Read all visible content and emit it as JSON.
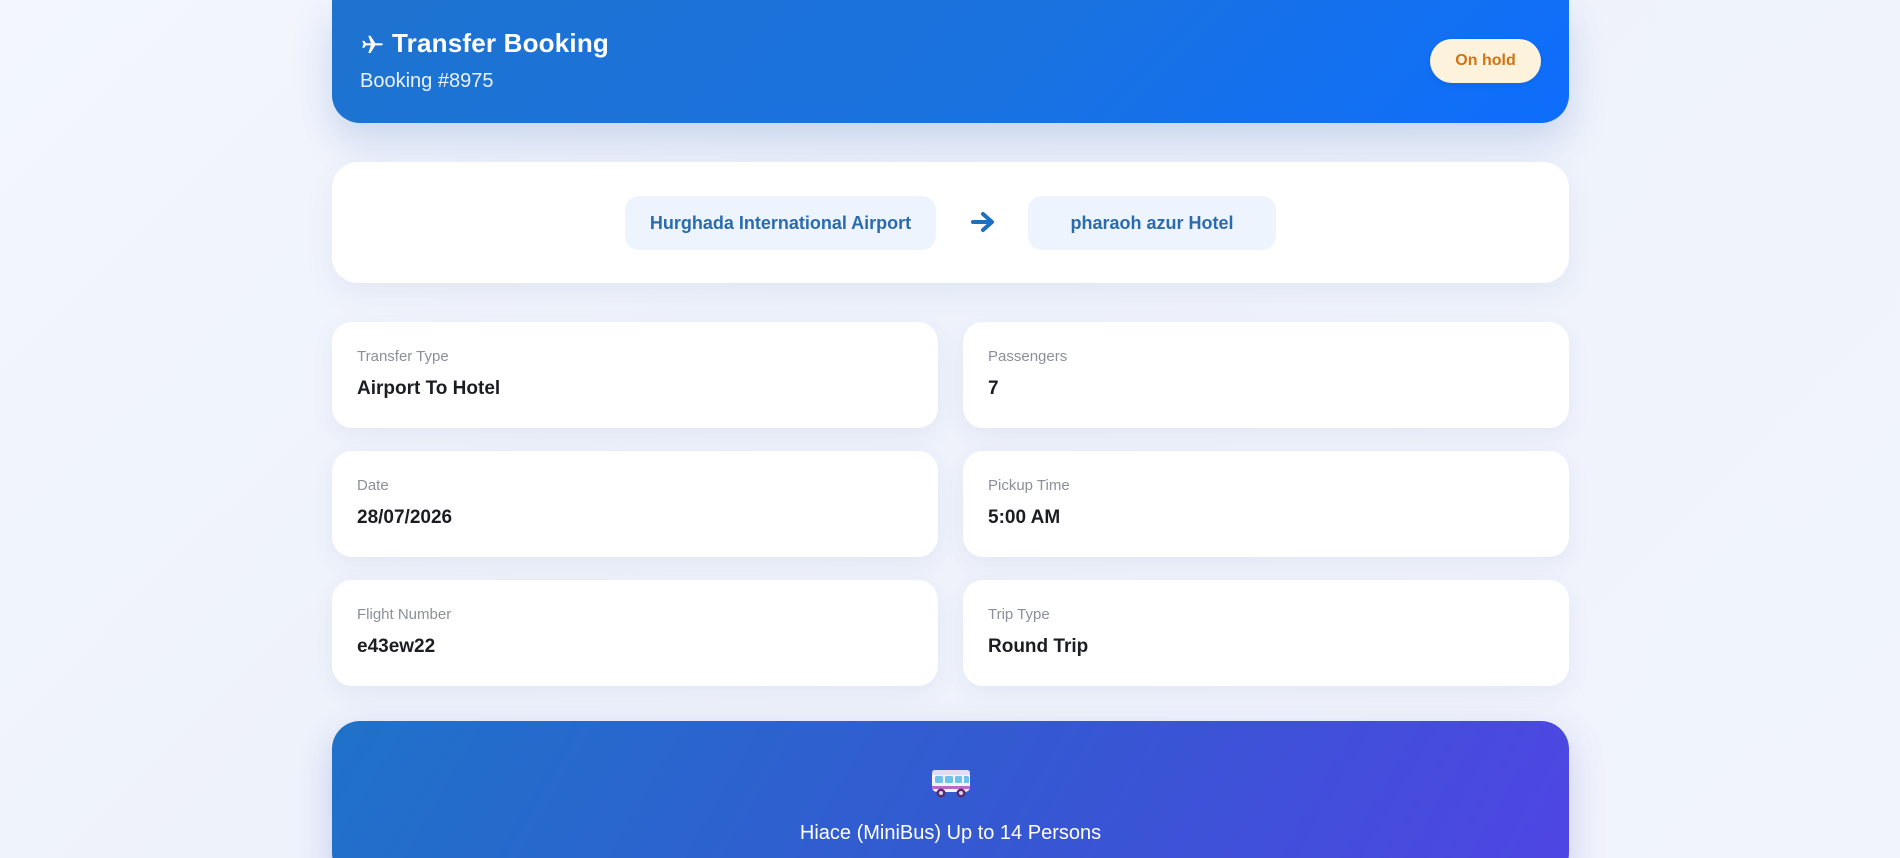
{
  "header": {
    "title": "Transfer Booking",
    "booking_number": "Booking #8975",
    "status": "On hold"
  },
  "route": {
    "from": "Hurghada International Airport",
    "to": "pharaoh azur Hotel"
  },
  "details": {
    "transfer_type": {
      "label": "Transfer Type",
      "value": "Airport To Hotel"
    },
    "passengers": {
      "label": "Passengers",
      "value": "7"
    },
    "date": {
      "label": "Date",
      "value": "28/07/2026"
    },
    "pickup_time": {
      "label": "Pickup Time",
      "value": "5:00 AM"
    },
    "flight_number": {
      "label": "Flight Number",
      "value": "e43ew22"
    },
    "trip_type": {
      "label": "Trip Type",
      "value": "Round Trip"
    }
  },
  "vehicle": {
    "name": "Hiace (MiniBus) Up to 14 Persons",
    "icon": "minibus-icon"
  },
  "icons": {
    "title_icon": "airplane-icon",
    "route_icon": "arrow-right-icon"
  },
  "colors": {
    "header_blue": "#1a72e0",
    "status_bg": "#fdf2dc",
    "status_text": "#d07312",
    "route_text": "#2a6bb0",
    "vehicle_gradient_end": "#4f45e4"
  }
}
